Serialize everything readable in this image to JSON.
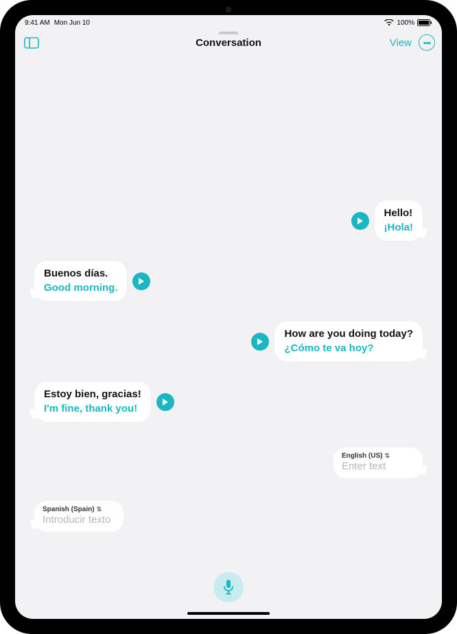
{
  "status": {
    "time": "9:41 AM",
    "date": "Mon Jun 10",
    "battery_pct": "100%"
  },
  "nav": {
    "title": "Conversation",
    "view_label": "View"
  },
  "messages": [
    {
      "side": "right",
      "source": "Hello!",
      "translation": "¡Hola!"
    },
    {
      "side": "left",
      "source": "Buenos días.",
      "translation": "Good morning."
    },
    {
      "side": "right",
      "source": "How are you doing today?",
      "translation": "¿Cómo te va hoy?"
    },
    {
      "side": "left",
      "source": "Estoy bien, gracias!",
      "translation": "I'm fine, thank you!"
    }
  ],
  "inputs": {
    "right": {
      "language": "English (US)",
      "placeholder": "Enter text"
    },
    "left": {
      "language": "Spanish (Spain)",
      "placeholder": "Introducir texto"
    }
  },
  "accent": "#19b7c3"
}
